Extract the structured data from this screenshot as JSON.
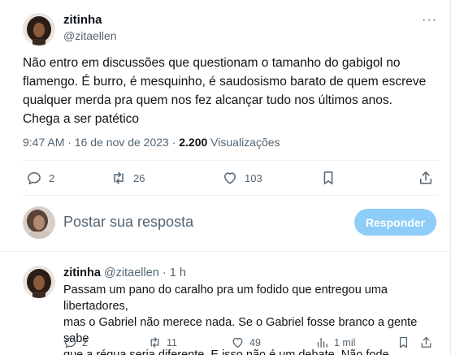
{
  "post": {
    "display_name": "zitinha",
    "handle": "@zitaellen",
    "more": "···",
    "text": "Não entro em discussões que questionam o tamanho do gabigol no flamengo. É burro, é mesquinho, é saudosismo barato de quem escreve qualquer merda pra quem nos fez alcançar tudo nos últimos anos.\nChega a ser patético",
    "time": "9:47 AM · 16 de nov de 2023 · ",
    "views_count": "2.200",
    "views_label": " Visualizações",
    "replies": "2",
    "reposts": "26",
    "likes": "103"
  },
  "composer": {
    "placeholder": "Postar sua resposta",
    "button": "Responder"
  },
  "reply": {
    "display_name": "zitinha",
    "handle_time": " @zitaellen · 1 h",
    "text": "Passam um pano do caralho pra um fodido que entregou uma libertadores,\nmas o Gabriel não merece nada. Se o Gabriel fosse branco a gente sabe\nque a régua seria diferente. E isso não é um debate. Não fode",
    "replies": "2",
    "reposts": "11",
    "likes": "49",
    "views": "1 mil"
  },
  "colors": {
    "text": "#0f1419",
    "secondary": "#536471",
    "button_disabled": "#8ecdf8",
    "divider": "#eff3f4"
  },
  "icons": [
    "reply-icon",
    "repost-icon",
    "like-icon",
    "bookmark-icon",
    "share-icon",
    "views-icon",
    "more-icon"
  ]
}
